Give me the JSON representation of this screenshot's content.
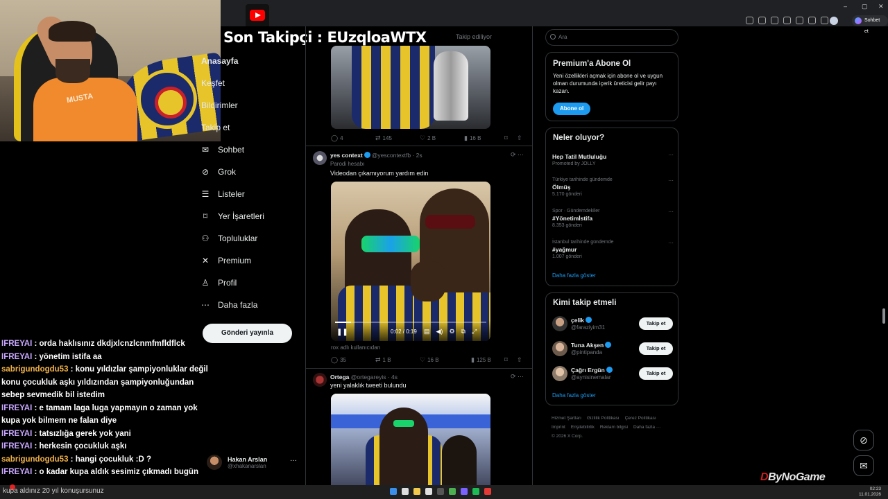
{
  "overlay": {
    "follower_banner": "Son Takipçi : EUzqloaWTX"
  },
  "nav": {
    "items": [
      {
        "label": "Anasayfa",
        "icon": "home-icon"
      },
      {
        "label": "Keşfet",
        "icon": "search-icon"
      },
      {
        "label": "Bildirimler",
        "icon": "bell-icon"
      },
      {
        "label": "Takip et",
        "icon": "follow-icon"
      },
      {
        "label": "Sohbet",
        "icon": "mail-icon"
      },
      {
        "label": "Grok",
        "icon": "grok-icon"
      },
      {
        "label": "Listeler",
        "icon": "list-icon"
      },
      {
        "label": "Yer İşaretleri",
        "icon": "bookmark-icon"
      },
      {
        "label": "Topluluklar",
        "icon": "communities-icon"
      },
      {
        "label": "Premium",
        "icon": "x-logo-icon"
      },
      {
        "label": "Profil",
        "icon": "person-icon"
      },
      {
        "label": "Daha fazla",
        "icon": "more-circle-icon"
      }
    ],
    "post_button": "Gönderi yayınla",
    "account": {
      "name": "Hakan Arslan",
      "handle": "@xhakanarslan",
      "more": "···"
    }
  },
  "timeline": {
    "following_tab": "Takip ediliyor",
    "tweet0_actions": {
      "replies": "4",
      "reposts": "145",
      "likes": "2 B",
      "views": "16 B"
    },
    "tweet1": {
      "name": "yes context",
      "handle": "@yescontextfb · 2s",
      "label": "Parodi hesabı",
      "text": "Videodan çıkamıyorum yardım edin",
      "video_time": "0:02 / 0:19",
      "video_progress": 0.105,
      "caption": "rox adlı kullanıcıdan",
      "actions": {
        "replies": "35",
        "reposts": "1 B",
        "likes": "16 B",
        "views": "125 B"
      }
    },
    "tweet2": {
      "name": "Ortega",
      "handle": "@ortegareyis · 4s",
      "text": "yeni yalaklık tweeti bulundu"
    }
  },
  "sidebar": {
    "search_placeholder": "Ara",
    "premium": {
      "title": "Premium'a Abone Ol",
      "desc": "Yeni özellikleri açmak için abone ol ve uygun olman durumunda içerik üreticisi gelir payı kazan.",
      "button": "Abone ol"
    },
    "trends": {
      "title": "Neler oluyor?",
      "items": [
        {
          "context": "",
          "topic": "Hep Tatil Mutluluğu",
          "count": "Promoted by JOLLY"
        },
        {
          "context": "Türkiye tarihinde gündemde",
          "topic": "Ölmüş",
          "count": "5.170 gönderi"
        },
        {
          "context": "Spor · Gündemdekiler",
          "topic": "#Yönetimİstifa",
          "count": "8.353 gönderi"
        },
        {
          "context": "İstanbul tarihinde gündemde",
          "topic": "#yağmur",
          "count": "1.007 gönderi"
        }
      ],
      "show_more": "Daha fazla göster"
    },
    "who_to_follow": {
      "title": "Kimi takip etmeli",
      "items": [
        {
          "name": "çelik",
          "handle": "@faraziyim31",
          "button": "Takip et"
        },
        {
          "name": "Tuna Akşen",
          "handle": "@pintipanda",
          "button": "Takip et"
        },
        {
          "name": "Çağrı Ergün",
          "handle": "@aynisinemalar",
          "button": "Takip et"
        }
      ],
      "show_more": "Daha fazla göster"
    },
    "footer": [
      "Hizmet Şartları",
      "Gizlilik Politikası",
      "Çerez Politikası",
      "Imprint",
      "Erişilebilirlik",
      "Reklam bilgisi",
      "Daha fazla ···",
      "© 2026 X Corp."
    ]
  },
  "chat": [
    {
      "user": "IFREYAI",
      "color": "u1",
      "text": " : orda haklısınız dkdjxlcnzlcnmfmfldflck"
    },
    {
      "user": "IFREYAI",
      "color": "u1",
      "text": " : yönetim istifa aa"
    },
    {
      "user": "sabrigundogdu53",
      "color": "u2",
      "text": " : konu yıldızlar şampiyonluklar değil konu çocukluk aşkı yıldızından şampiyonluğundan sebep sevmedik bil istedim"
    },
    {
      "user": "IFREYAI",
      "color": "u1",
      "text": " : e tamam laga luga yapmayın o zaman yok kupa yok bilmem ne falan diye"
    },
    {
      "user": "IFREYAI",
      "color": "u1",
      "text": " : tatsızlığa gerek yok yani"
    },
    {
      "user": "IFREYAI",
      "color": "u1",
      "text": " : herkesin çocukluk aşkı"
    },
    {
      "user": "sabrigundogdu53",
      "color": "u2",
      "text": " : hangi çocukluk :D ?"
    },
    {
      "user": "IFREYAI",
      "color": "u1",
      "text": " : o kadar kupa aldık sesimiz çıkmadı bugün"
    }
  ],
  "ticker": "kupa aldınız 20 yıl konuşursunuz",
  "watermark": {
    "d": "D",
    "rest": "ByNoGame"
  },
  "browser": {
    "sohbet_label": "Sohbet et"
  },
  "clock": {
    "time": "02:23",
    "date": "11.01.2026"
  },
  "colors": {
    "accent": "#1d9bf0",
    "bg": "#000000",
    "border": "#2f3336",
    "muted": "#71767b"
  }
}
